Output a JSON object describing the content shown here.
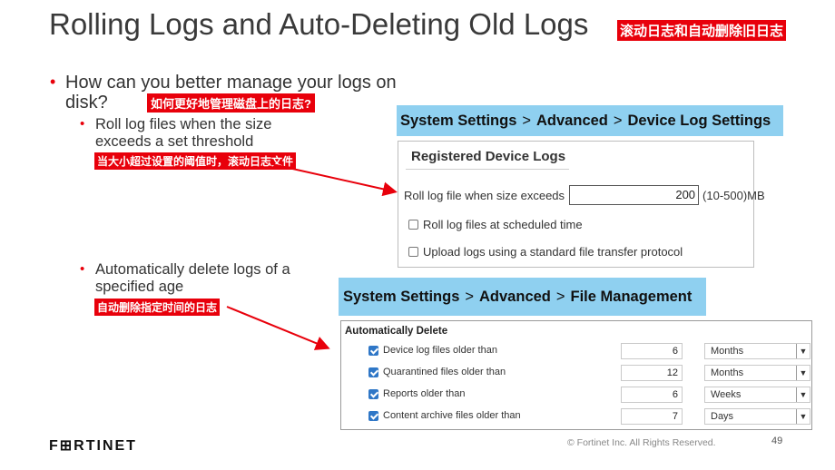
{
  "slide": {
    "title": "Rolling Logs and Auto-Deleting Old Logs",
    "title_cn": "滚动日志和自动删除旧日志",
    "bullet_main": "How can you better manage your logs on disk?",
    "bullet_main_cn": "如何更好地管理磁盘上的日志?",
    "sub1": "Roll log files when the size exceeds a set threshold",
    "sub1_cn": "当大小超过设置的阈值时，滚动日志文件",
    "sub2": "Automatically delete logs of a specified age",
    "sub2_cn": "自动删除指定时间的日志",
    "accent_color": "#e8000b",
    "path_highlight_color": "#8fd0f0"
  },
  "path1": {
    "p1": "System Settings",
    "sep": ">",
    "p2": "Advanced",
    "p3": "Device Log Settings"
  },
  "path2": {
    "p1": "System Settings",
    "sep": ">",
    "p2": "Advanced",
    "p3": "File Management"
  },
  "device_logs": {
    "header": "Registered Device Logs",
    "roll_label": "Roll log file when size exceeds",
    "roll_value": "200",
    "roll_unit": "(10-500)MB",
    "scheduled_label": "Roll log files at scheduled time",
    "scheduled_checked": false,
    "upload_label": "Upload logs using a standard file transfer protocol",
    "upload_checked": false
  },
  "auto_delete": {
    "header": "Automatically Delete",
    "rows": [
      {
        "label": "Device log files older than",
        "value": "6",
        "unit": "Months",
        "checked": true
      },
      {
        "label": "Quarantined files older than",
        "value": "12",
        "unit": "Months",
        "checked": true
      },
      {
        "label": "Reports older than",
        "value": "6",
        "unit": "Weeks",
        "checked": true
      },
      {
        "label": "Content archive files older than",
        "value": "7",
        "unit": "Days",
        "checked": true
      }
    ]
  },
  "footer": {
    "logo": "F⊞RTINET",
    "copyright": "© Fortinet Inc. All Rights Reserved.",
    "page": "49"
  }
}
